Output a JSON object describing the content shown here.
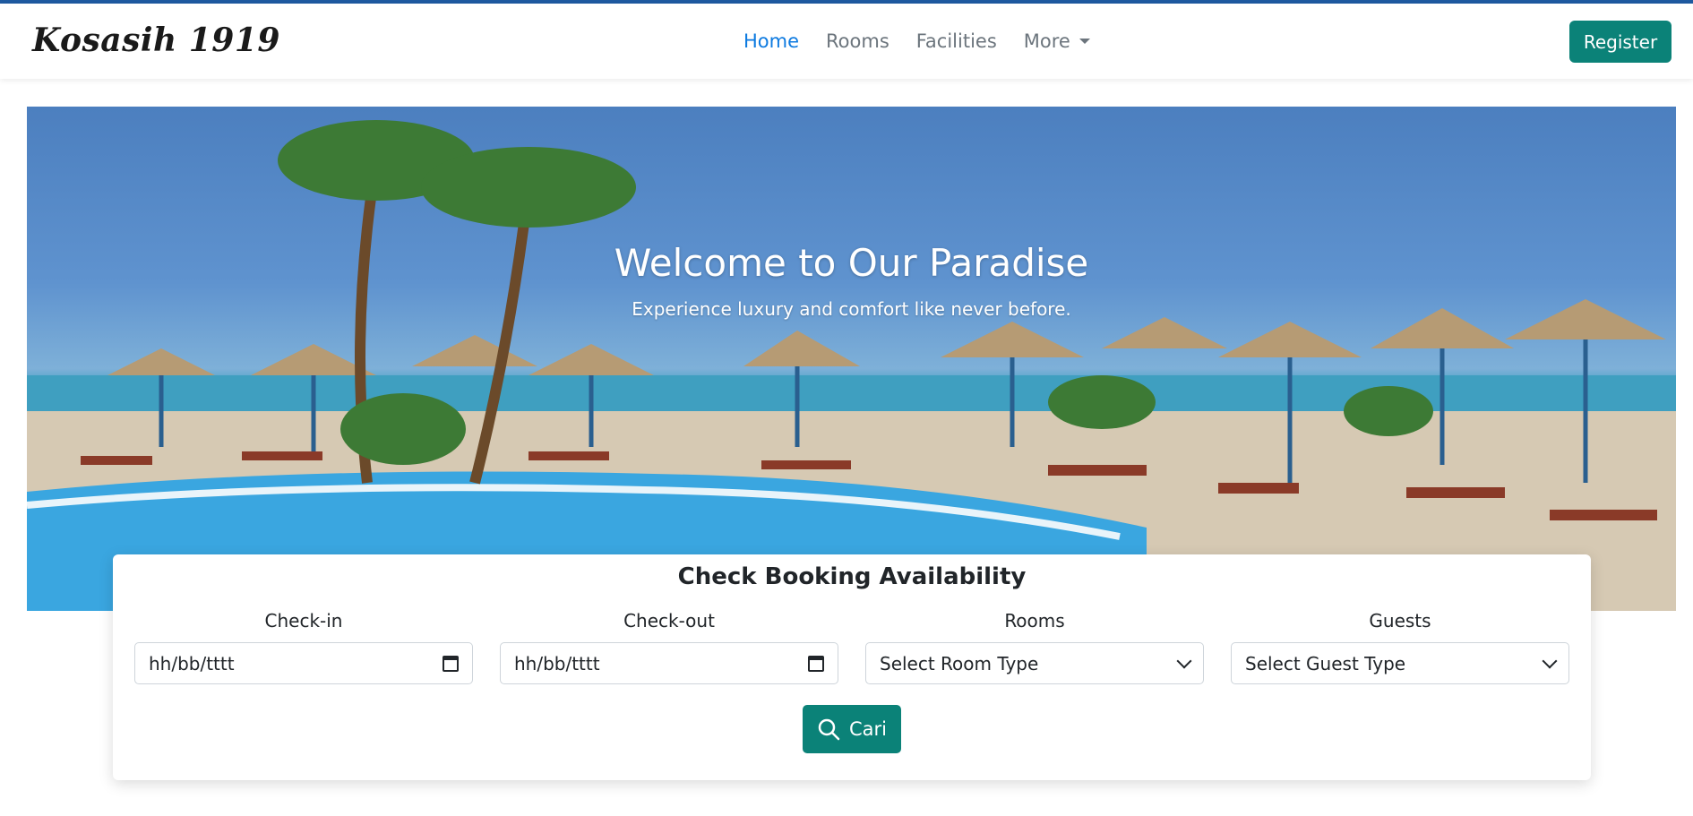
{
  "brand": "Kosasih 1919",
  "nav": {
    "items": [
      "Home",
      "Rooms",
      "Facilities",
      "More"
    ],
    "register_label": "Register"
  },
  "hero": {
    "title": "Welcome to Our Paradise",
    "subtitle": "Experience luxury and comfort like never before."
  },
  "booking": {
    "title": "Check Booking Availability",
    "checkin_label": "Check-in",
    "checkin_value": "hh/bb/tttt",
    "checkout_label": "Check-out",
    "checkout_value": "hh/bb/tttt",
    "rooms_label": "Rooms",
    "rooms_value": "Select Room Type",
    "guests_label": "Guests",
    "guests_value": "Select Guest Type",
    "search_label": "Cari"
  },
  "colors": {
    "primary": "#0b8278",
    "nav_active": "#0d7ae0",
    "top_border": "#1e5aa0"
  }
}
